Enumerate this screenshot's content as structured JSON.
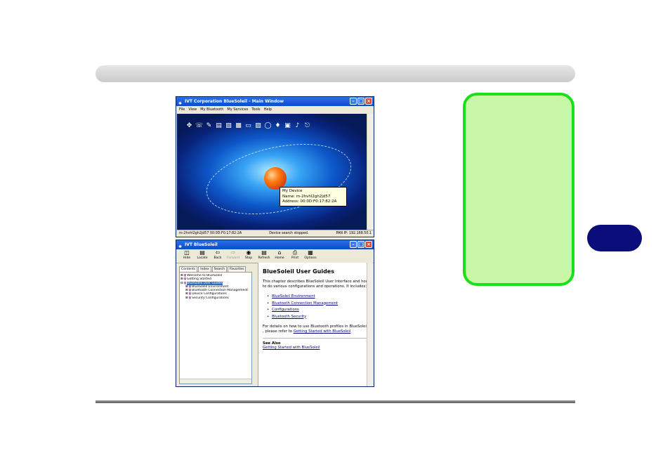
{
  "window1": {
    "title": "IVT Corporation BlueSoleil - Main Window",
    "menu": [
      "File",
      "View",
      "My Bluetooth",
      "My Services",
      "Tools",
      "Help"
    ],
    "tooltip": {
      "line1": "My Device",
      "line2": "Name: m-2hvhl2gh2jd57",
      "line3": "Address: 00:0D:F0:17:82:2A"
    },
    "status": {
      "left": "m-2hvhl2gh2jd57 00:0D:F0:17:82:2A",
      "middle": "Device search stopped.",
      "right": "PAN IP: 192.168.50.1"
    }
  },
  "window2": {
    "title": "IVT BlueSoleil",
    "toolbar": [
      "Hide",
      "Locate",
      "Back",
      "Forward",
      "Stop",
      "Refresh",
      "Home",
      "Print",
      "Options"
    ],
    "tabs": [
      "Contents",
      "Index",
      "Search",
      "Favorites"
    ],
    "tree": [
      "Welcome to BlueSoleil",
      "Getting Started",
      "BlueSoleil User Guides",
      "BlueSoleil Environment",
      "Bluetooth Connection Management",
      "Device Configurations",
      "Security Configurations"
    ],
    "content": {
      "title": "BlueSoleil User Guides",
      "intro": "This chapter describes BlueSoleil User Interface and how to do various configurations and operations. It includes:",
      "links": [
        "BlueSoleil Environment",
        "Bluetooth Connection Management",
        "Configurations",
        "Bluetooth Security"
      ],
      "details_prefix": "For details on how to use Bluetooth profiles in BlueSoleil , please refer to",
      "details_link": "Getting Started with BlueSoleil",
      "see_also_label": "See Also",
      "see_also_link": "Getting Started with BlueSoleil"
    }
  }
}
